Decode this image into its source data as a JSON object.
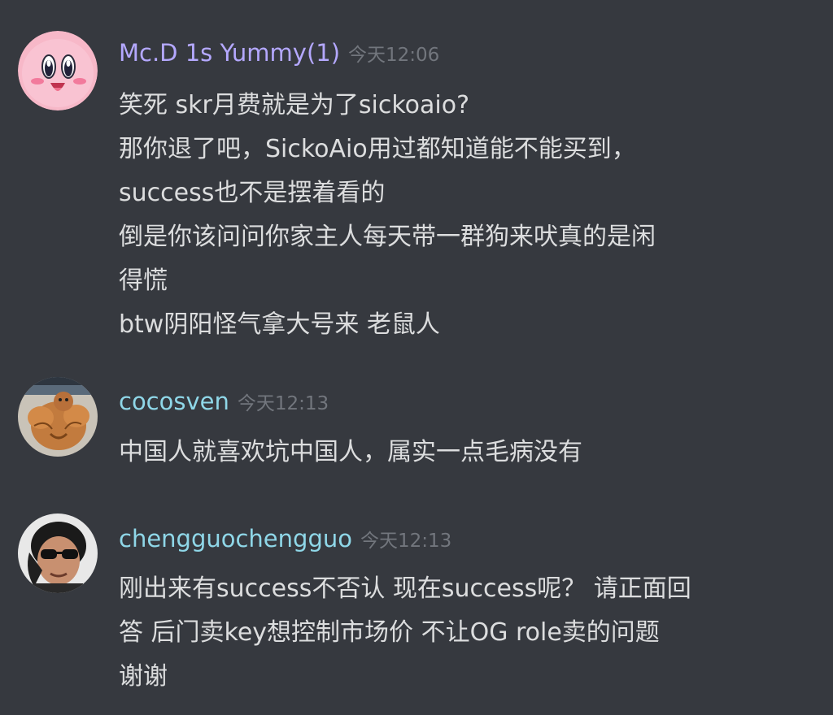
{
  "messages": [
    {
      "username": "Mc.D 1s Yummy(1)",
      "username_color": "#b4a8ff",
      "timestamp": "今天12:06",
      "lines": [
        "笑死 skr月费就是为了sickoaio?",
        "那你退了吧，SickoAio用过都知道能不能买到，",
        "success也不是摆着看的",
        "倒是你该问问你家主人每天带一群狗来吠真的是闲",
        "得慌",
        "btw阴阳怪气拿大号来 老鼠人"
      ]
    },
    {
      "username": "cocosven",
      "username_color": "#8fd7e8",
      "timestamp": "今天12:13",
      "lines": [
        "中国人就喜欢坑中国人，属实一点毛病没有"
      ]
    },
    {
      "username": "chengguochengguo",
      "username_color": "#8fd7e8",
      "timestamp": "今天12:13",
      "lines": [
        "刚出来有success不否认  现在success呢？ 请正面回",
        "答  后门卖key想控制市场价  不让OG role卖的问题",
        "谢谢"
      ]
    }
  ]
}
